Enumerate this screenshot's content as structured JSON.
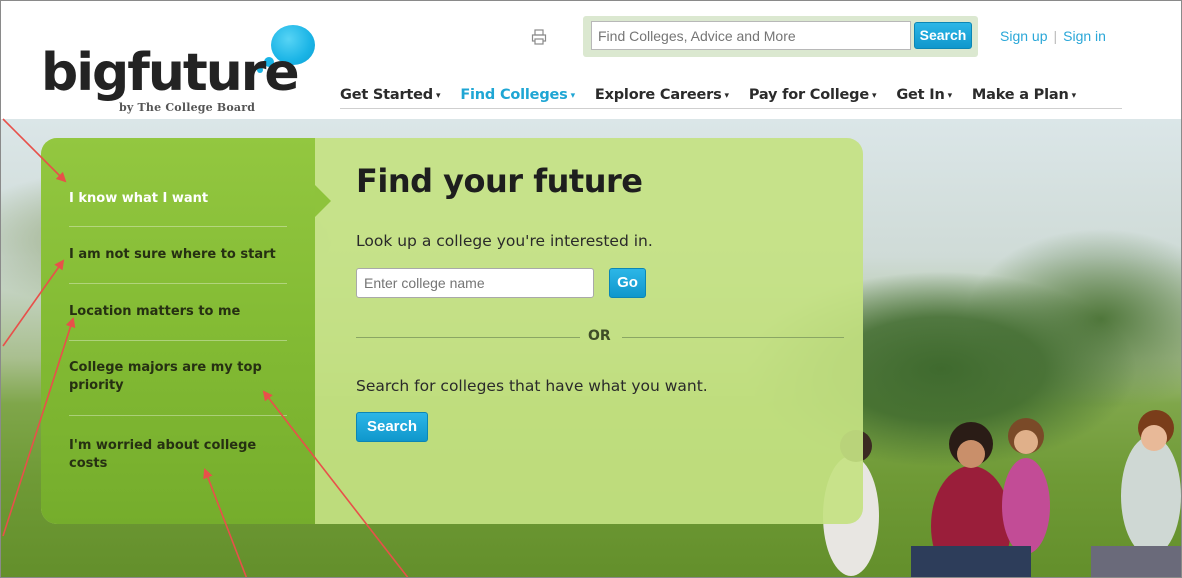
{
  "header": {
    "logo_text": "bigfuture",
    "logo_subtitle": "by The College Board",
    "search": {
      "placeholder": "Find Colleges, Advice and More",
      "button_label": "Search"
    },
    "auth": {
      "sign_up": "Sign up",
      "separator": "|",
      "sign_in": "Sign in"
    },
    "icons": {
      "print": "print-icon"
    }
  },
  "nav": {
    "items": [
      {
        "label": "Get Started",
        "active": false
      },
      {
        "label": "Find Colleges",
        "active": true
      },
      {
        "label": "Explore Careers",
        "active": false
      },
      {
        "label": "Pay for College",
        "active": false
      },
      {
        "label": "Get In",
        "active": false
      },
      {
        "label": "Make a Plan",
        "active": false
      }
    ],
    "caret": "▾"
  },
  "sidebar": {
    "items": [
      {
        "label": "I know what I want",
        "active": true
      },
      {
        "label": "I am not sure where to start",
        "active": false
      },
      {
        "label": "Location matters to me",
        "active": false
      },
      {
        "label": "College majors are my top priority",
        "active": false
      },
      {
        "label": "I'm worried about college costs",
        "active": false
      }
    ]
  },
  "main": {
    "title": "Find your future",
    "lookup_prompt": "Look up a college you're interested in.",
    "college_input_placeholder": "Enter college name",
    "go_label": "Go",
    "or_label": "OR",
    "search_prompt": "Search for colleges that have what you want.",
    "search_label": "Search"
  },
  "colors": {
    "accent_blue": "#1fa6d4",
    "sidebar_green": "#83bb34",
    "panel_green": "#c4e282",
    "annotation_red": "#e8504a"
  }
}
